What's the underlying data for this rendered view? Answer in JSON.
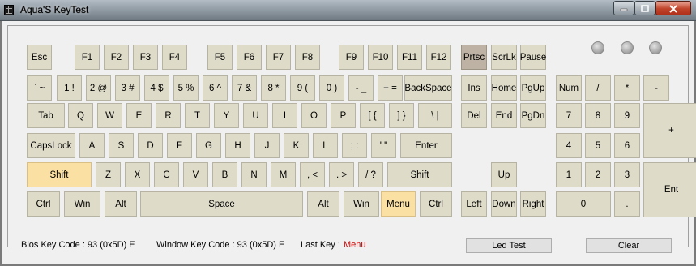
{
  "window": {
    "title": "Aqua'S KeyTest"
  },
  "leds": [
    "num-lock-led",
    "caps-lock-led",
    "scroll-lock-led"
  ],
  "keys": [
    {
      "name": "key-esc",
      "label": "Esc"
    },
    {
      "name": "key-f1",
      "label": "F1"
    },
    {
      "name": "key-f2",
      "label": "F2"
    },
    {
      "name": "key-f3",
      "label": "F3"
    },
    {
      "name": "key-f4",
      "label": "F4"
    },
    {
      "name": "key-f5",
      "label": "F5"
    },
    {
      "name": "key-f6",
      "label": "F6"
    },
    {
      "name": "key-f7",
      "label": "F7"
    },
    {
      "name": "key-f8",
      "label": "F8"
    },
    {
      "name": "key-f9",
      "label": "F9"
    },
    {
      "name": "key-f10",
      "label": "F10"
    },
    {
      "name": "key-f11",
      "label": "F11"
    },
    {
      "name": "key-f12",
      "label": "F12"
    },
    {
      "name": "key-prtsc",
      "label": "Prtsc",
      "state": "dark"
    },
    {
      "name": "key-scrlk",
      "label": "ScrLk"
    },
    {
      "name": "key-pause",
      "label": "Pause"
    },
    {
      "name": "key-backtick",
      "label": "` ~"
    },
    {
      "name": "key-1",
      "label": "1 !"
    },
    {
      "name": "key-2",
      "label": "2 @"
    },
    {
      "name": "key-3",
      "label": "3 #"
    },
    {
      "name": "key-4",
      "label": "4 $"
    },
    {
      "name": "key-5",
      "label": "5 %"
    },
    {
      "name": "key-6",
      "label": "6 ^"
    },
    {
      "name": "key-7",
      "label": "7 &"
    },
    {
      "name": "key-8",
      "label": "8 *"
    },
    {
      "name": "key-9",
      "label": "9 ("
    },
    {
      "name": "key-0",
      "label": "0 )"
    },
    {
      "name": "key-minus",
      "label": "- _"
    },
    {
      "name": "key-equals",
      "label": "+ ="
    },
    {
      "name": "key-backspace",
      "label": "BackSpace"
    },
    {
      "name": "key-ins",
      "label": "Ins"
    },
    {
      "name": "key-home",
      "label": "Home"
    },
    {
      "name": "key-pgup",
      "label": "PgUp"
    },
    {
      "name": "key-numlock",
      "label": "Num"
    },
    {
      "name": "key-num-divide",
      "label": "/"
    },
    {
      "name": "key-num-multiply",
      "label": "*"
    },
    {
      "name": "key-num-minus",
      "label": "-"
    },
    {
      "name": "key-tab",
      "label": "Tab"
    },
    {
      "name": "key-q",
      "label": "Q"
    },
    {
      "name": "key-w",
      "label": "W"
    },
    {
      "name": "key-e",
      "label": "E"
    },
    {
      "name": "key-r",
      "label": "R"
    },
    {
      "name": "key-t",
      "label": "T"
    },
    {
      "name": "key-y",
      "label": "Y"
    },
    {
      "name": "key-u",
      "label": "U"
    },
    {
      "name": "key-i",
      "label": "I"
    },
    {
      "name": "key-o",
      "label": "O"
    },
    {
      "name": "key-p",
      "label": "P"
    },
    {
      "name": "key-lbracket",
      "label": "[ {"
    },
    {
      "name": "key-rbracket",
      "label": "] }"
    },
    {
      "name": "key-backslash",
      "label": "\\ |"
    },
    {
      "name": "key-del",
      "label": "Del"
    },
    {
      "name": "key-end",
      "label": "End"
    },
    {
      "name": "key-pgdn",
      "label": "PgDn"
    },
    {
      "name": "key-num-7",
      "label": "7"
    },
    {
      "name": "key-num-8",
      "label": "8"
    },
    {
      "name": "key-num-9",
      "label": "9"
    },
    {
      "name": "key-num-plus",
      "label": "+"
    },
    {
      "name": "key-capslock",
      "label": "CapsLock"
    },
    {
      "name": "key-a",
      "label": "A"
    },
    {
      "name": "key-s",
      "label": "S"
    },
    {
      "name": "key-d",
      "label": "D"
    },
    {
      "name": "key-f",
      "label": "F"
    },
    {
      "name": "key-g",
      "label": "G"
    },
    {
      "name": "key-h",
      "label": "H"
    },
    {
      "name": "key-j",
      "label": "J"
    },
    {
      "name": "key-k",
      "label": "K"
    },
    {
      "name": "key-l",
      "label": "L"
    },
    {
      "name": "key-semicolon",
      "label": "; :"
    },
    {
      "name": "key-quote",
      "label": "' \""
    },
    {
      "name": "key-enter",
      "label": "Enter"
    },
    {
      "name": "key-num-4",
      "label": "4"
    },
    {
      "name": "key-num-5",
      "label": "5"
    },
    {
      "name": "key-num-6",
      "label": "6"
    },
    {
      "name": "key-lshift",
      "label": "Shift",
      "state": "highlight"
    },
    {
      "name": "key-z",
      "label": "Z"
    },
    {
      "name": "key-x",
      "label": "X"
    },
    {
      "name": "key-c",
      "label": "C"
    },
    {
      "name": "key-v",
      "label": "V"
    },
    {
      "name": "key-b",
      "label": "B"
    },
    {
      "name": "key-n",
      "label": "N"
    },
    {
      "name": "key-m",
      "label": "M"
    },
    {
      "name": "key-comma",
      "label": ", <"
    },
    {
      "name": "key-period",
      "label": ". >"
    },
    {
      "name": "key-slash",
      "label": "/ ?"
    },
    {
      "name": "key-rshift",
      "label": "Shift"
    },
    {
      "name": "key-up",
      "label": "Up"
    },
    {
      "name": "key-num-1",
      "label": "1"
    },
    {
      "name": "key-num-2",
      "label": "2"
    },
    {
      "name": "key-num-3",
      "label": "3"
    },
    {
      "name": "key-num-enter",
      "label": "Ent"
    },
    {
      "name": "key-lctrl",
      "label": "Ctrl"
    },
    {
      "name": "key-lwin",
      "label": "Win"
    },
    {
      "name": "key-lalt",
      "label": "Alt"
    },
    {
      "name": "key-space",
      "label": "Space"
    },
    {
      "name": "key-ralt",
      "label": "Alt"
    },
    {
      "name": "key-rwin",
      "label": "Win"
    },
    {
      "name": "key-menu",
      "label": "Menu",
      "state": "highlight"
    },
    {
      "name": "key-rctrl",
      "label": "Ctrl"
    },
    {
      "name": "key-left",
      "label": "Left"
    },
    {
      "name": "key-down",
      "label": "Down"
    },
    {
      "name": "key-right",
      "label": "Right"
    },
    {
      "name": "key-num-0",
      "label": "0"
    },
    {
      "name": "key-num-decimal",
      "label": "."
    }
  ],
  "status": {
    "bios_key_code": "Bios Key Code : 93 (0x5D) E",
    "window_key_code": "Window Key Code : 93 (0x5D) E",
    "last_key_label": "Last Key :",
    "last_key_value": "Menu"
  },
  "buttons": {
    "led_test": "Led Test",
    "clear": "Clear"
  },
  "colors": {
    "key": "#dedbc8",
    "highlight": "#fbe0a3",
    "pressed": "#bdb2a3",
    "last_key": "#cc0000"
  }
}
